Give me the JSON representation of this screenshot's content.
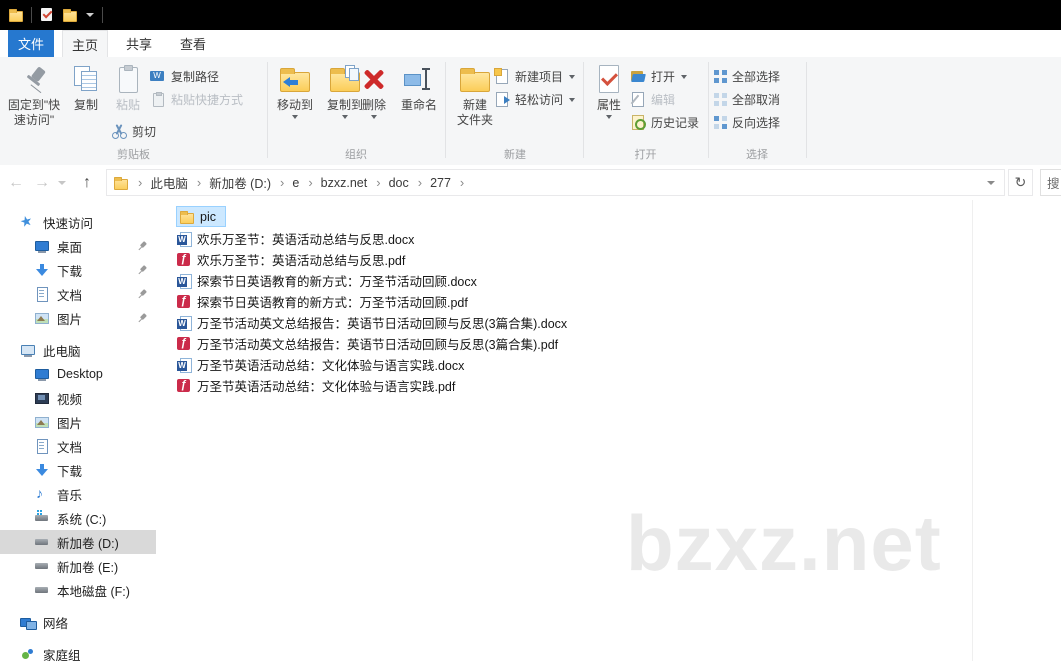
{
  "colors": {
    "accent_blue": "#2678cf",
    "selection_bg": "#cce8ff",
    "selection_border": "#99d1ff",
    "sidebar_selected": "#d9d9d9",
    "folder_yellow": "#fbcf5d",
    "word_blue": "#2a5699",
    "pdf_red": "#cb2b4a",
    "delete_red": "#ce2a2a",
    "watermark_gray": "#e9e9e9",
    "titlebar": "#000000",
    "ribbon_bg": "#f5f6f7"
  },
  "tabs": {
    "file": "文件",
    "home": "主页",
    "share": "共享",
    "view": "查看"
  },
  "ribbon": {
    "pin_to_quick": "固定到\"快速访问\"",
    "copy": "复制",
    "paste": "粘贴",
    "copy_path": "复制路径",
    "paste_shortcut": "粘贴快捷方式",
    "cut": "剪切",
    "group_clipboard": "剪贴板",
    "move_to": "移动到",
    "copy_to": "复制到",
    "delete": "删除",
    "rename": "重命名",
    "group_organize": "组织",
    "new_folder_line1": "新建",
    "new_folder_line2": "文件夹",
    "new_item": "新建项目",
    "easy_access": "轻松访问",
    "group_new": "新建",
    "properties": "属性",
    "open": "打开",
    "edit": "编辑",
    "history": "历史记录",
    "group_open": "打开",
    "select_all": "全部选择",
    "select_none": "全部取消",
    "invert_selection": "反向选择",
    "group_select": "选择"
  },
  "addressbar": {
    "segments": [
      "此电脑",
      "新加卷 (D:)",
      "e",
      "bzxz.net",
      "doc",
      "277"
    ],
    "search_text": "搜"
  },
  "sidebar": {
    "quick_access": "快速访问",
    "qa_items": [
      {
        "label": "桌面"
      },
      {
        "label": "下载"
      },
      {
        "label": "文档"
      },
      {
        "label": "图片"
      }
    ],
    "this_pc": "此电脑",
    "pc_items": [
      {
        "label": "Desktop"
      },
      {
        "label": "视频"
      },
      {
        "label": "图片"
      },
      {
        "label": "文档"
      },
      {
        "label": "下载"
      },
      {
        "label": "音乐"
      },
      {
        "label": "系统 (C:)"
      },
      {
        "label": "新加卷 (D:)"
      },
      {
        "label": "新加卷 (E:)"
      },
      {
        "label": "本地磁盘 (F:)"
      }
    ],
    "network": "网络",
    "homegroup": "家庭组"
  },
  "files": [
    {
      "name": "pic",
      "type": "folder",
      "selected": true
    },
    {
      "name": "欢乐万圣节：英语活动总结与反思.docx",
      "type": "docx"
    },
    {
      "name": "欢乐万圣节：英语活动总结与反思.pdf",
      "type": "pdf"
    },
    {
      "name": "探索节日英语教育的新方式：万圣节活动回顾.docx",
      "type": "docx"
    },
    {
      "name": "探索节日英语教育的新方式：万圣节活动回顾.pdf",
      "type": "pdf"
    },
    {
      "name": "万圣节活动英文总结报告：英语节日活动回顾与反思(3篇合集).docx",
      "type": "docx"
    },
    {
      "name": "万圣节活动英文总结报告：英语节日活动回顾与反思(3篇合集).pdf",
      "type": "pdf"
    },
    {
      "name": "万圣节英语活动总结：文化体验与语言实践.docx",
      "type": "docx"
    },
    {
      "name": "万圣节英语活动总结：文化体验与语言实践.pdf",
      "type": "pdf"
    }
  ],
  "watermark": "bzxz.net"
}
